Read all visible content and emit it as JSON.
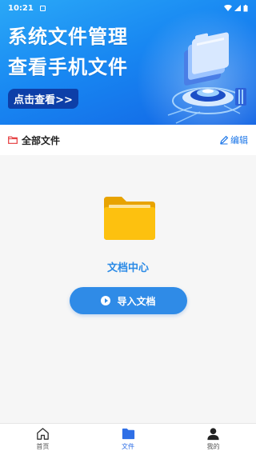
{
  "status_bar": {
    "time": "10:21"
  },
  "banner": {
    "headline_line1": "系统文件管理",
    "headline_line2": "查看手机文件",
    "cta_label": "点击查看>>"
  },
  "section": {
    "title": "全部文件",
    "edit_label": "编辑"
  },
  "empty_state": {
    "label": "文档中心",
    "import_button_label": "导入文档"
  },
  "bottom_nav": {
    "items": [
      {
        "label": "首页",
        "icon": "home-icon",
        "active": false
      },
      {
        "label": "文件",
        "icon": "folder-icon",
        "active": true
      },
      {
        "label": "我的",
        "icon": "person-icon",
        "active": false
      }
    ]
  },
  "colors": {
    "primary": "#2f8be7",
    "banner_dark": "#0d3fa8",
    "folder": "#f5b60b",
    "nav_active": "#2f6fe6"
  }
}
